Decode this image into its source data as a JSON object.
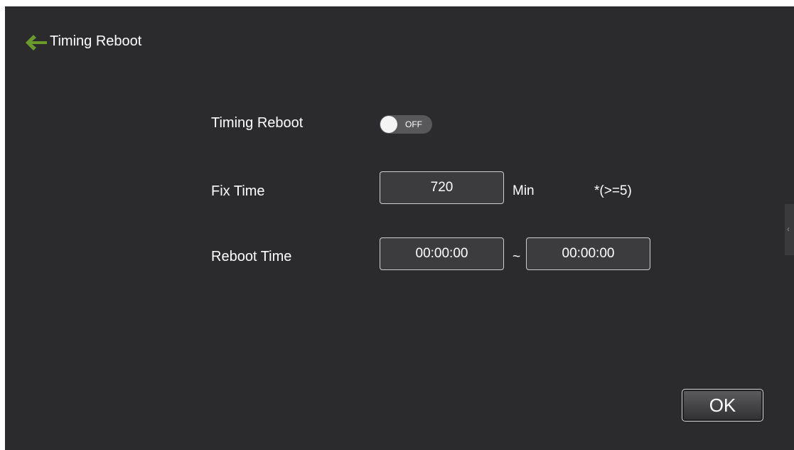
{
  "header": {
    "title": "Timing Reboot",
    "back_icon": "arrow-left-icon",
    "back_icon_color": "#6a9a2c"
  },
  "settings": {
    "timing_reboot": {
      "label": "Timing Reboot",
      "toggle_state": "OFF"
    },
    "fix_time": {
      "label": "Fix Time",
      "value": "720",
      "unit": "Min",
      "hint": "*(>=5)"
    },
    "reboot_time": {
      "label": "Reboot Time",
      "start": "00:00:00",
      "separator": "~",
      "end": "00:00:00"
    }
  },
  "side_handle_icon": "chevron-left-icon",
  "ok_button": {
    "label": "OK"
  },
  "colors": {
    "background": "#2b2b2e",
    "accent": "#6a9a2c"
  }
}
